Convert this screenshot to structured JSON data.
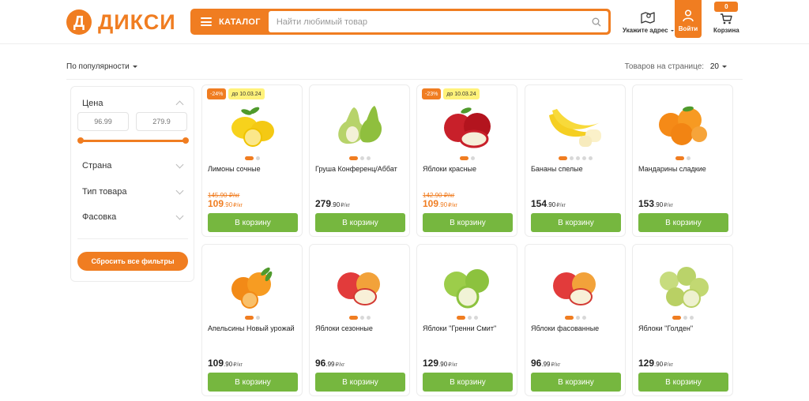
{
  "brand": {
    "logo_letter": "Д",
    "name": "ДИКСИ"
  },
  "header": {
    "catalog_label": "КАТАЛОГ",
    "search_placeholder": "Найти любимый товар",
    "address_label": "Укажите адрес",
    "login_label": "Войти",
    "cart_label": "Корзина",
    "cart_count": "0"
  },
  "sort": {
    "label": "По популярности",
    "per_page_label": "Товаров на странице:",
    "per_page_value": "20"
  },
  "filters": {
    "price_title": "Цена",
    "price_min": "96.99",
    "price_max": "279.9",
    "country": "Страна",
    "type": "Тип товара",
    "packaging": "Фасовка",
    "reset": "Сбросить  все фильтры"
  },
  "colors": {
    "brand_orange": "#f07d21",
    "button_green": "#76b73f",
    "badge_yellow": "#fff27a"
  },
  "buy_label": "В корзину",
  "products": [
    {
      "name": "Лимоны сочные",
      "discount": "-24%",
      "until": "до 10.03.24",
      "old_price": "145.90 ₽/кг",
      "rub": "109",
      "kop": ".90",
      "unit": "₽/кг",
      "sale": true,
      "dots": 2,
      "image": "lemon-icon"
    },
    {
      "name": "Груша Конференц/Аббат",
      "discount": "",
      "until": "",
      "old_price": "",
      "rub": "279",
      "kop": ".90",
      "unit": "₽/кг",
      "sale": false,
      "dots": 3,
      "image": "pear-icon"
    },
    {
      "name": "Яблоки красные",
      "discount": "-23%",
      "until": "до 10.03.24",
      "old_price": "142.90 ₽/кг",
      "rub": "109",
      "kop": ".90",
      "unit": "₽/кг",
      "sale": true,
      "dots": 2,
      "image": "red-apple-icon"
    },
    {
      "name": "Бананы спелые",
      "discount": "",
      "until": "",
      "old_price": "",
      "rub": "154",
      "kop": ".90",
      "unit": "₽/кг",
      "sale": false,
      "dots": 5,
      "image": "banana-icon"
    },
    {
      "name": "Мандарины сладкие",
      "discount": "",
      "until": "",
      "old_price": "",
      "rub": "153",
      "kop": ".90",
      "unit": "₽/кг",
      "sale": false,
      "dots": 2,
      "image": "mandarin-icon"
    },
    {
      "name": "Апельсины Новый урожай",
      "discount": "",
      "until": "",
      "old_price": "",
      "rub": "109",
      "kop": ".90",
      "unit": "₽/кг",
      "sale": false,
      "dots": 2,
      "image": "orange-icon"
    },
    {
      "name": "Яблоки сезонные",
      "discount": "",
      "until": "",
      "old_price": "",
      "rub": "96",
      "kop": ".99",
      "unit": "₽/кг",
      "sale": false,
      "dots": 3,
      "image": "apple-icon"
    },
    {
      "name": "Яблоки \"Гренни Смит\"",
      "discount": "",
      "until": "",
      "old_price": "",
      "rub": "129",
      "kop": ".90",
      "unit": "₽/кг",
      "sale": false,
      "dots": 3,
      "image": "green-apple-icon"
    },
    {
      "name": "Яблоки фасованные",
      "discount": "",
      "until": "",
      "old_price": "",
      "rub": "96",
      "kop": ".99",
      "unit": "₽/кг",
      "sale": false,
      "dots": 3,
      "image": "apple-icon"
    },
    {
      "name": "Яблоки \"Голден\"",
      "discount": "",
      "until": "",
      "old_price": "",
      "rub": "129",
      "kop": ".90",
      "unit": "₽/кг",
      "sale": false,
      "dots": 3,
      "image": "golden-apple-icon"
    }
  ]
}
